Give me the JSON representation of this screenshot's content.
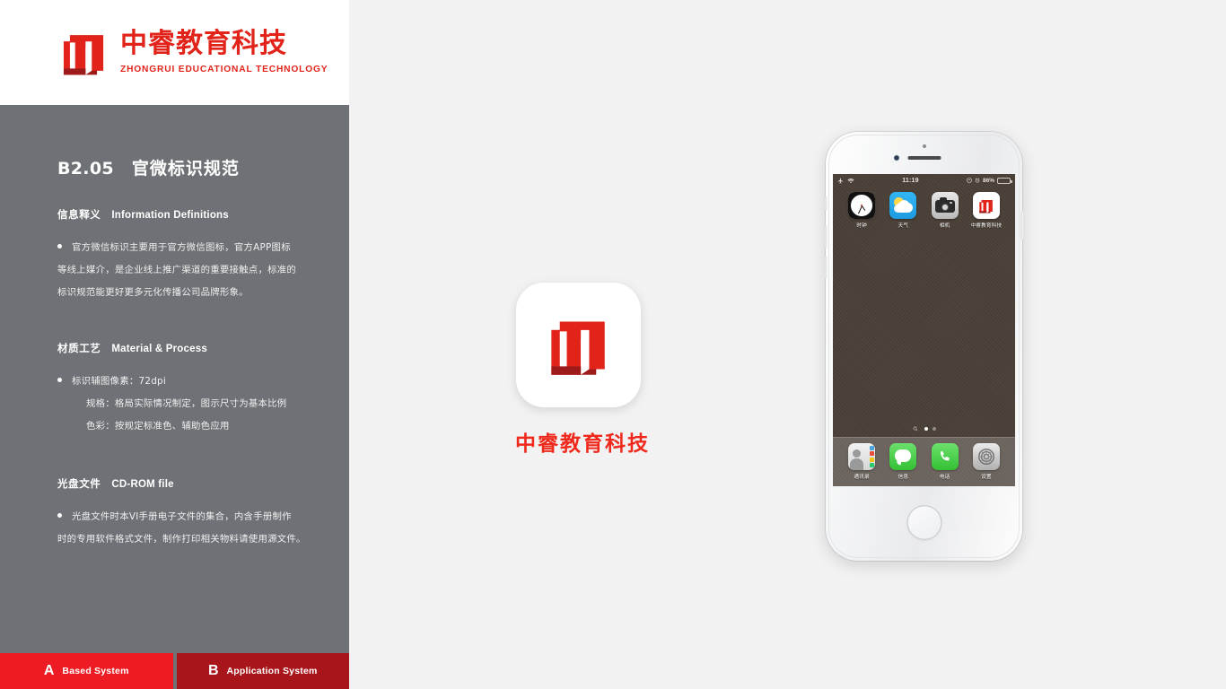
{
  "brand": {
    "name_cn": "中睿教育科技",
    "name_en": "ZHONGRUI EDUCATIONAL TECHNOLOGY",
    "logo_icon": "open-book-logo-icon",
    "primary_red": "#e2231a",
    "dark_red": "#a8151a"
  },
  "sidebar": {
    "background_color": "#6e7175",
    "section_number": "B2.05",
    "section_title_cn": "官微标识规范",
    "blocks": [
      {
        "head_cn": "信息释义",
        "head_en": "Information Definitions",
        "lines": [
          "官方微信标识主要用于官方微信图标，官方APP图标",
          "等线上媒介，是企业线上推广渠道的重要接触点，标准的",
          "标识规范能更好更多元化传播公司品牌形象。"
        ]
      },
      {
        "head_cn": "材质工艺",
        "head_en": "Material & Process",
        "lines": [
          "标识辅图像素：72dpi",
          "规格：格局实际情况制定，图示尺寸为基本比例",
          "色彩：按规定标准色、辅助色应用"
        ]
      },
      {
        "head_cn": "光盘文件",
        "head_en": "CD-ROM  file",
        "lines": [
          "光盘文件时本VI手册电子文件的集合，内含手册制作",
          "时的专用软件格式文件，制作打印相关物料请使用源文件。"
        ]
      }
    ]
  },
  "footer_tabs": [
    {
      "letter": "A",
      "label": "Based System",
      "color": "#ed1c24",
      "active": true
    },
    {
      "letter": "B",
      "label": "Application System",
      "color": "#a8151a",
      "active": false
    }
  ],
  "showcase": {
    "icon_name": "brand-app-icon",
    "label": "中睿教育科技",
    "label_color": "#ef2a1d",
    "tile_background": "#ffffff"
  },
  "phone": {
    "device": "iphone-6-silver",
    "wallpaper_color": "#4a4038",
    "status_bar": {
      "airplane_icon": "airplane-icon",
      "wifi_icon": "wifi-icon",
      "time": "11:19",
      "lock_icon": "rotation-lock-icon",
      "alarm_icon": "alarm-icon",
      "battery_percent": "86%",
      "battery_level": 86
    },
    "home_apps": [
      {
        "name": "时钟",
        "icon": "clock-icon"
      },
      {
        "name": "天气",
        "icon": "weather-icon"
      },
      {
        "name": "相机",
        "icon": "camera-icon"
      },
      {
        "name": "中睿教育科技",
        "icon": "brand-app-icon"
      }
    ],
    "page_indicator": {
      "search_icon": "search-icon",
      "pages": 2,
      "active_page": 1
    },
    "dock_apps": [
      {
        "name": "通讯录",
        "icon": "contacts-icon"
      },
      {
        "name": "信息",
        "icon": "messages-icon"
      },
      {
        "name": "电话",
        "icon": "phone-icon"
      },
      {
        "name": "设置",
        "icon": "settings-icon"
      }
    ],
    "home_button": "home-button"
  }
}
